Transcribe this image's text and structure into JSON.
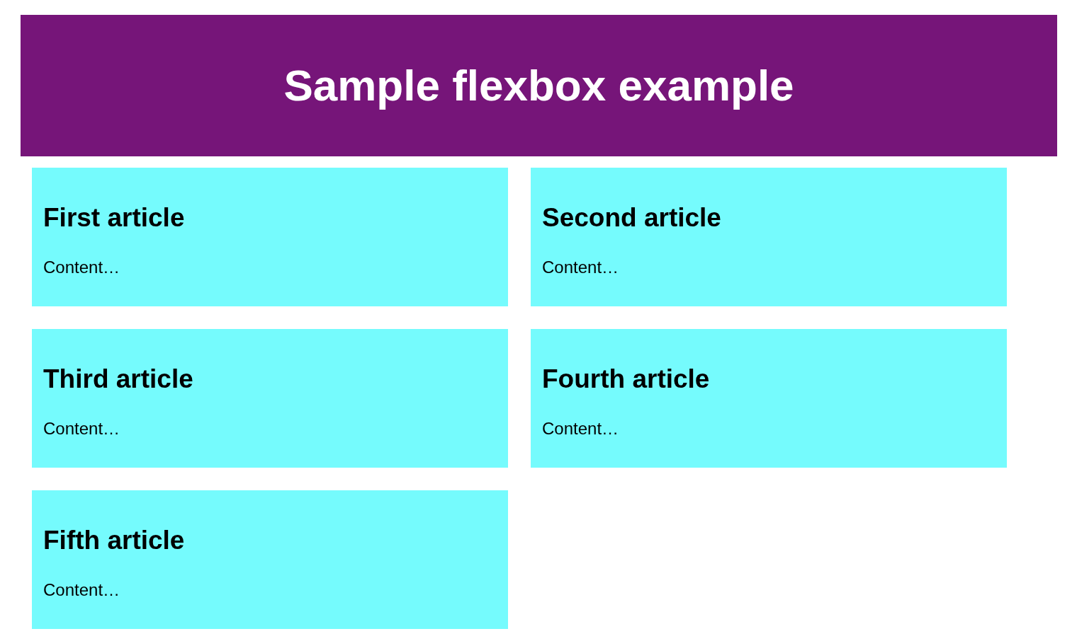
{
  "header": {
    "title": "Sample flexbox example"
  },
  "articles": [
    {
      "title": "First article",
      "content": "Content…"
    },
    {
      "title": "Second article",
      "content": "Content…"
    },
    {
      "title": "Third article",
      "content": "Content…"
    },
    {
      "title": "Fourth article",
      "content": "Content…"
    },
    {
      "title": "Fifth article",
      "content": "Content…"
    }
  ]
}
